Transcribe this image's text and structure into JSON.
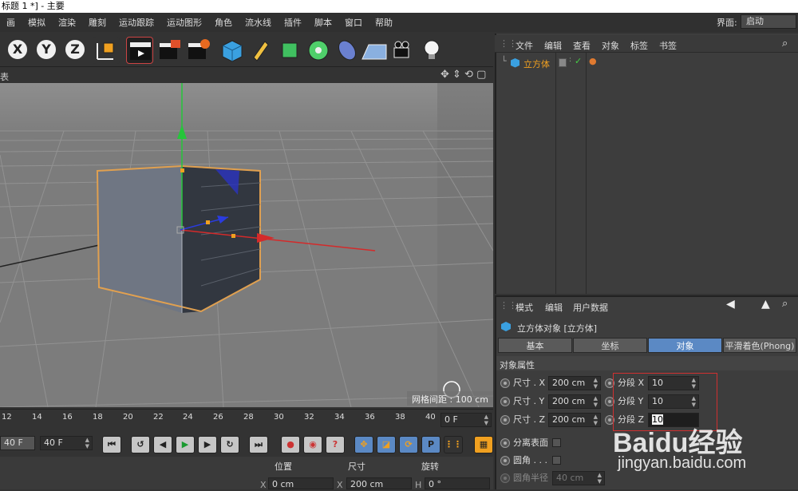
{
  "window": {
    "title": "标题 1 *] - 主要"
  },
  "menu": [
    "画",
    "模拟",
    "渲染",
    "雕刻",
    "运动跟踪",
    "运动图形",
    "角色",
    "流水线",
    "插件",
    "脚本",
    "窗口",
    "帮助"
  ],
  "layout": {
    "label": "界面:",
    "value": "启动"
  },
  "toolbar": {
    "x": "X",
    "y": "Y",
    "z": "Z"
  },
  "viewport": {
    "header": "表",
    "grid_spacing": "网格间距 : 100 cm"
  },
  "timeline": {
    "ticks": [
      "12",
      "14",
      "16",
      "18",
      "20",
      "22",
      "24",
      "26",
      "28",
      "30",
      "32",
      "34",
      "36",
      "38",
      "40"
    ],
    "frame_field": "0 F"
  },
  "transport": {
    "start": "40 F",
    "end": "40 F"
  },
  "coords": {
    "pos": "位置",
    "size": "尺寸",
    "rot": "旋转",
    "px_label": "X",
    "px": "0 cm",
    "sx_label": "X",
    "sx": "200 cm",
    "h_label": "H",
    "h": "0 °"
  },
  "object_manager": {
    "menu": [
      "文件",
      "编辑",
      "查看",
      "对象",
      "标签",
      "书签"
    ],
    "objects": [
      {
        "name": "立方体"
      }
    ]
  },
  "attributes": {
    "menu": [
      "模式",
      "编辑",
      "用户数据"
    ],
    "title": "立方体对象 [立方体]",
    "tabs": [
      "基本",
      "坐标",
      "对象",
      "平滑着色(Phong)"
    ],
    "section": "对象属性",
    "size": [
      {
        "label": "尺寸 . X",
        "value": "200 cm"
      },
      {
        "label": "尺寸 . Y",
        "value": "200 cm"
      },
      {
        "label": "尺寸 . Z",
        "value": "200 cm"
      }
    ],
    "segments": [
      {
        "label": "分段 X",
        "value": "10"
      },
      {
        "label": "分段 Y",
        "value": "10"
      },
      {
        "label": "分段 Z",
        "value": "10"
      }
    ],
    "separate": "分离表面",
    "fillet": "圆角 . . .",
    "fillet_radius": {
      "label": "圆角半径",
      "value": "40 cm"
    }
  },
  "watermark": {
    "brand": "Baidu经验",
    "url": "jingyan.baidu.com"
  }
}
